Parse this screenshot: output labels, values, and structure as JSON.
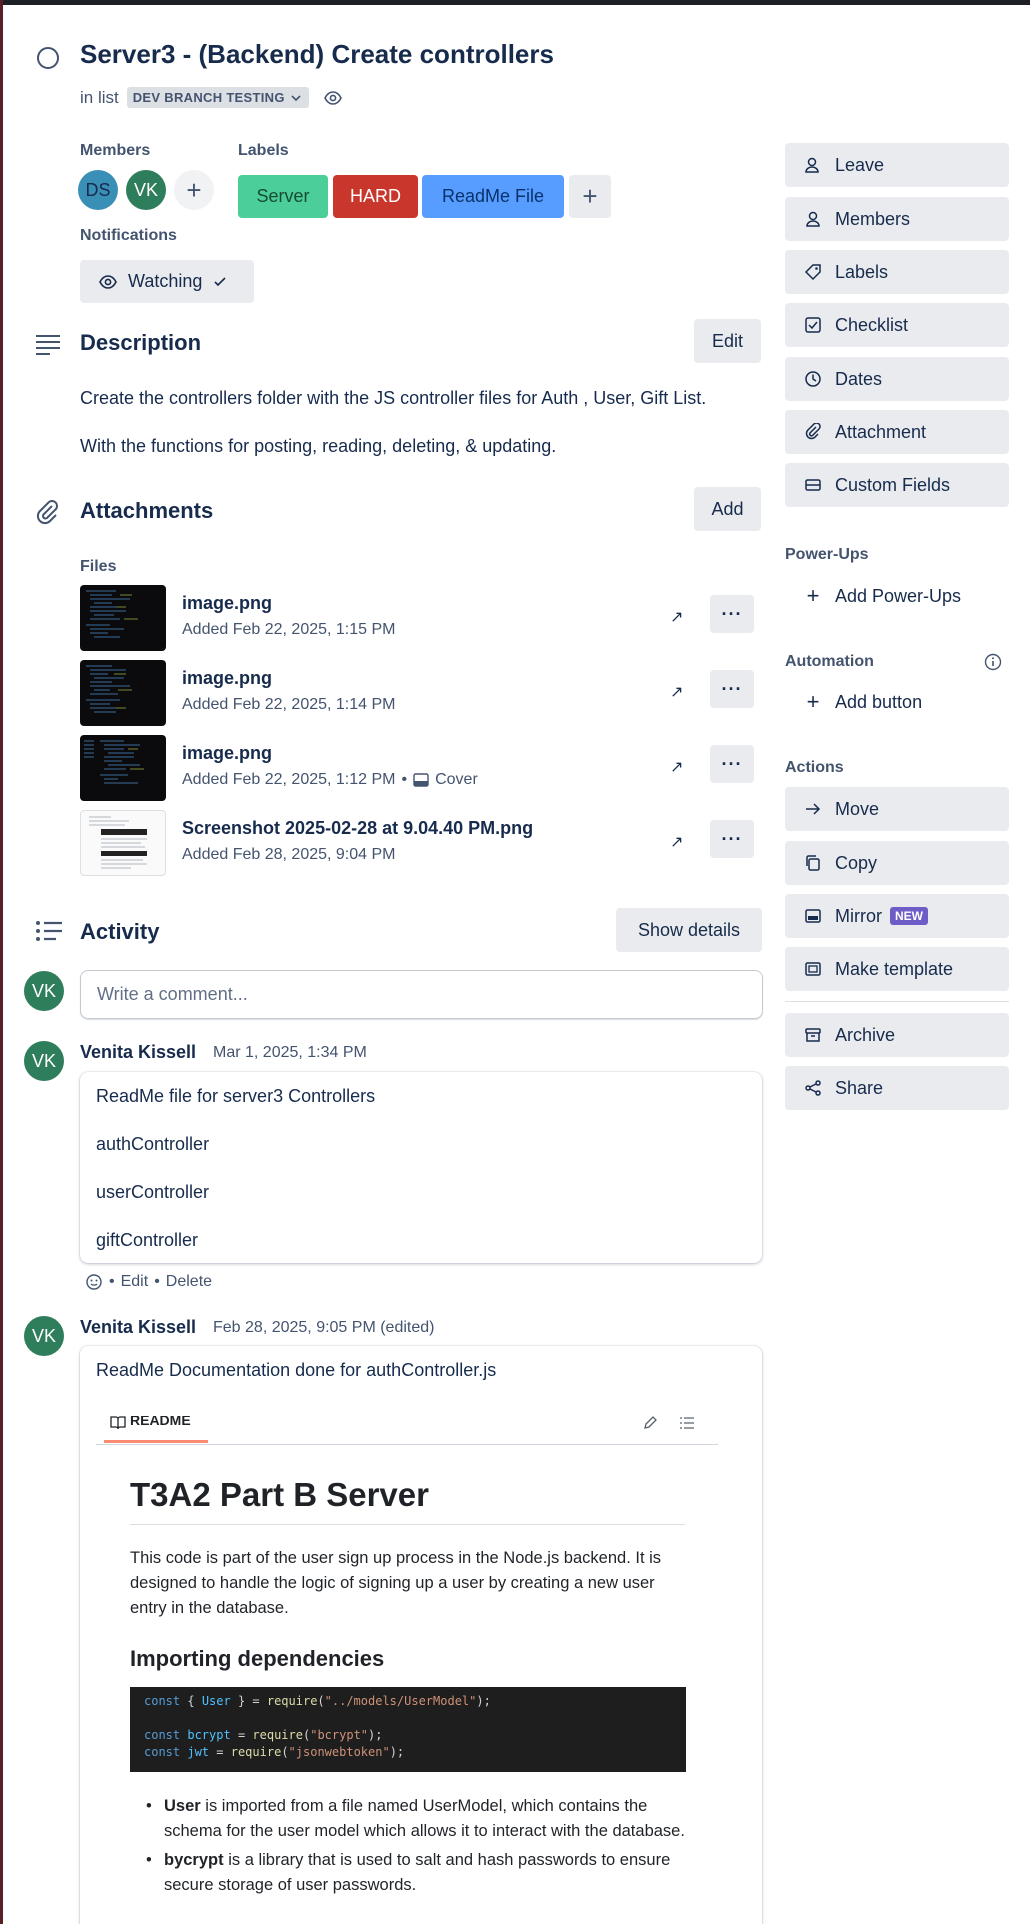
{
  "card": {
    "title": "Server3 - (Backend) Create controllers",
    "in_list_prefix": "in list",
    "list_name": "DEV BRANCH TESTING"
  },
  "members": {
    "label": "Members",
    "avatars": [
      {
        "initials": "DS",
        "color": "#3a8fb7"
      },
      {
        "initials": "VK",
        "color": "#2e7d5b"
      }
    ]
  },
  "labels": {
    "label": "Labels",
    "items": [
      {
        "text": "Server",
        "color": "#4bce97",
        "text_color": "#164b35"
      },
      {
        "text": "HARD",
        "color": "#c9372c",
        "text_color": "#ffffff"
      },
      {
        "text": "ReadMe File",
        "color": "#579dff",
        "text_color": "#09326c"
      }
    ]
  },
  "notifications": {
    "label": "Notifications",
    "watch_label": "Watching"
  },
  "description": {
    "heading": "Description",
    "edit_label": "Edit",
    "paragraphs": [
      "Create the controllers folder with the JS controller files for Auth , User, Gift List.",
      "With the functions for posting, reading, deleting, & updating."
    ]
  },
  "attachments": {
    "heading": "Attachments",
    "add_label": "Add",
    "files_label": "Files",
    "items": [
      {
        "name": "image.png",
        "meta": "Added Feb 22, 2025, 1:15 PM",
        "cover": ""
      },
      {
        "name": "image.png",
        "meta": "Added Feb 22, 2025, 1:14 PM",
        "cover": ""
      },
      {
        "name": "image.png",
        "meta": "Added Feb 22, 2025, 1:12 PM",
        "cover": "Cover"
      },
      {
        "name": "Screenshot 2025-02-28 at 9.04.40 PM.png",
        "meta": "Added Feb 28, 2025, 9:04 PM",
        "cover": ""
      }
    ]
  },
  "activity": {
    "heading": "Activity",
    "show_details_label": "Show details",
    "comment_placeholder": "Write a comment...",
    "current_user_initials": "VK",
    "comments": [
      {
        "initials": "VK",
        "author": "Venita Kissell",
        "date": "Mar 1, 2025, 1:34 PM",
        "lines": [
          "ReadMe file for server3 Controllers",
          "authController",
          "userController",
          "giftController"
        ],
        "actions": {
          "edit": "Edit",
          "delete": "Delete"
        }
      },
      {
        "initials": "VK",
        "author": "Venita Kissell",
        "date": "Feb 28, 2025, 9:05 PM (edited)",
        "lines": [
          "ReadMe Documentation done for authController.js"
        ]
      }
    ]
  },
  "readme_image": {
    "tab_label": "README",
    "h1": "T3A2 Part B Server",
    "intro": "This code is part of the user sign up process in the Node.js backend. It is designed to handle the logic of signing up a user by creating a new user entry in the database.",
    "h2": "Importing dependencies",
    "code_lines": [
      "const { User } = require(\"../models/UserModel\");",
      "",
      "const bcrypt = require(\"bcrypt\");",
      "const jwt = require(\"jsonwebtoken\");"
    ],
    "bullets": [
      {
        "term": "User",
        "text": " is imported from a file named UserModel, which contains the schema for the user model which allows it to interact with the database."
      },
      {
        "term": "bycrypt",
        "text": " is a library that is used to salt and hash passwords to ensure secure storage of user passwords."
      }
    ]
  },
  "sidebar": {
    "main_buttons": [
      {
        "label": "Leave",
        "icon": "person-minus-icon"
      },
      {
        "label": "Members",
        "icon": "person-icon"
      },
      {
        "label": "Labels",
        "icon": "tag-icon"
      },
      {
        "label": "Checklist",
        "icon": "checklist-icon"
      },
      {
        "label": "Dates",
        "icon": "clock-icon"
      },
      {
        "label": "Attachment",
        "icon": "paperclip-icon"
      },
      {
        "label": "Custom Fields",
        "icon": "custom-fields-icon"
      }
    ],
    "powerups_label": "Power-Ups",
    "add_powerups_label": "Add Power-Ups",
    "automation_label": "Automation",
    "add_button_label": "Add button",
    "actions_label": "Actions",
    "action_buttons": [
      {
        "label": "Move",
        "icon": "arrow-right-icon"
      },
      {
        "label": "Copy",
        "icon": "copy-icon"
      },
      {
        "label": "Mirror",
        "icon": "mirror-icon",
        "badge": "NEW"
      },
      {
        "label": "Make template",
        "icon": "template-icon"
      },
      {
        "label": "Archive",
        "icon": "archive-icon"
      },
      {
        "label": "Share",
        "icon": "share-icon"
      }
    ]
  }
}
